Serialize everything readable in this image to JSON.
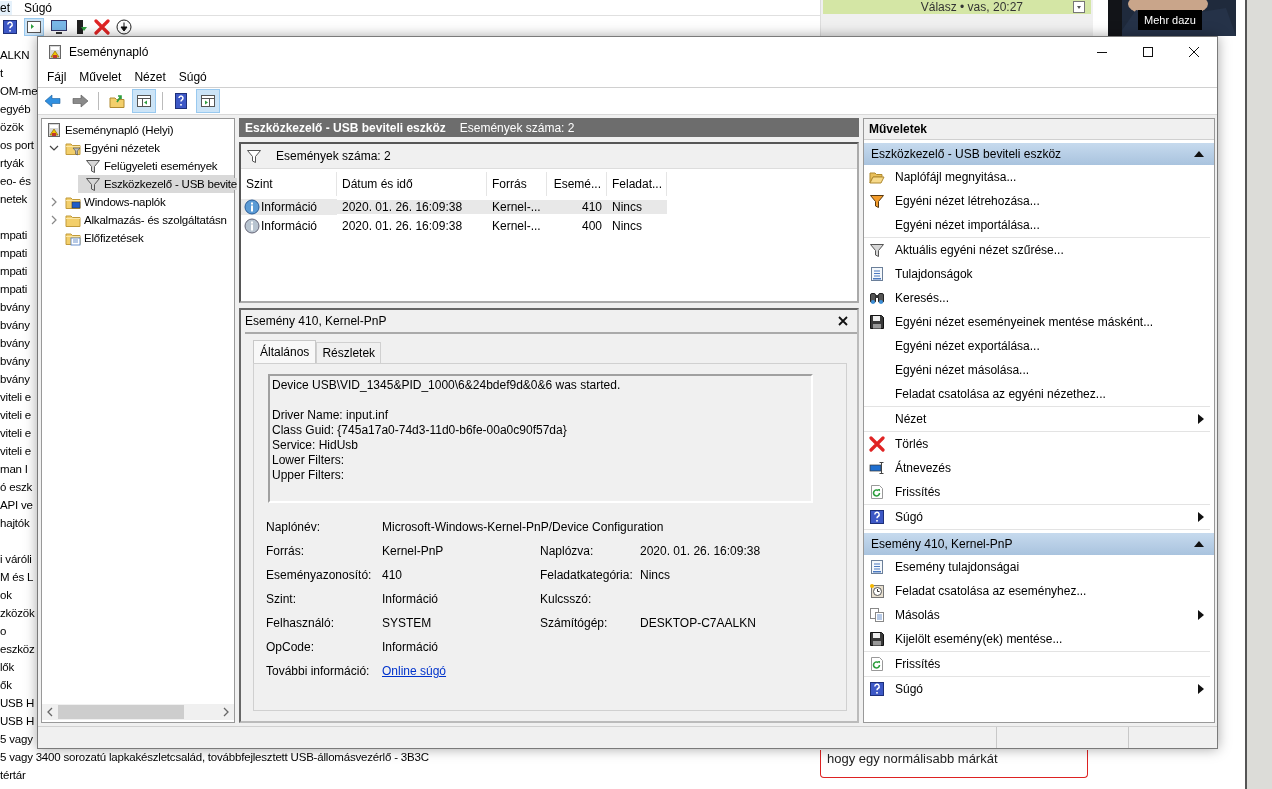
{
  "background_app": {
    "menu": [
      "et",
      "Súgó"
    ],
    "device_groups": [
      [
        "ALKN",
        "t",
        "OM-me",
        "egyéb",
        "özök",
        "os port",
        "rtyák",
        "eo- és",
        "netek"
      ],
      [
        "mpati",
        "mpati",
        "mpati",
        "mpati",
        "bvány",
        "bvány",
        "bvány",
        "bvány",
        "bvány",
        "viteli e",
        "viteli e",
        "viteli e",
        "viteli e",
        "man I",
        "ó eszk",
        "API ve",
        "hajtók"
      ],
      [
        "i váróli",
        "M és L",
        "ok",
        "zközök",
        "o",
        "eszköz",
        "lők",
        "ők",
        "USB H",
        "USB H",
        "5 vagy",
        "5 vagy 3400 sorozatú lapkakészletcsalád, továbbfejlesztett USB-állomásvezérlő - 3B3C",
        "tértár"
      ]
    ]
  },
  "web_page": {
    "reply_meta": "Válasz • vas, 20:27",
    "ad_label": "Mehr dazu",
    "comment_text": "hogy egy normálisabb márkát"
  },
  "window": {
    "title": "Eseménynapló",
    "menu": [
      "Fájl",
      "Művelet",
      "Nézet",
      "Súgó"
    ],
    "toolbar": [
      [
        {
          "kind": "back",
          "pressed": false
        },
        {
          "kind": "forward",
          "pressed": false
        }
      ],
      [
        {
          "kind": "up",
          "pressed": false
        },
        {
          "kind": "tree",
          "pressed": true
        }
      ],
      [
        {
          "kind": "help",
          "pressed": false
        },
        {
          "kind": "actionpane",
          "pressed": true
        }
      ]
    ]
  },
  "tree": [
    {
      "label": "Eseménynapló (Helyi)",
      "kind": "log",
      "selected": false,
      "children": [
        {
          "label": "Egyéni nézetek",
          "kind": "filterfolder",
          "expanded": true,
          "selected": false,
          "children": [
            {
              "label": "Felügyeleti események",
              "kind": "filter",
              "selected": false
            },
            {
              "label": "Eszközkezelő - USB bevite",
              "kind": "filter",
              "selected": true
            }
          ]
        },
        {
          "label": "Windows-naplók",
          "kind": "windowsfolder",
          "expanded": false,
          "selected": false
        },
        {
          "label": "Alkalmazás- és szolgáltatásn",
          "kind": "folder",
          "expanded": false,
          "selected": false
        },
        {
          "label": "Előfizetések",
          "kind": "subsfolder",
          "selected": false
        }
      ]
    }
  ],
  "events": {
    "header_title": "Eszközkezelő - USB beviteli eszköz",
    "header_count": "Események száma: 2",
    "filter_text": "Események száma: 2",
    "columns": [
      "Szint",
      "Dátum és idő",
      "Forrás",
      "Esemé...",
      "Feladat..."
    ],
    "rows": [
      {
        "selected": true,
        "kind": "info",
        "cells": [
          "Információ",
          "2020. 01. 26. 16:09:38",
          "Kernel-...",
          "410",
          "Nincs"
        ]
      },
      {
        "selected": false,
        "kind": "info",
        "cells": [
          "Információ",
          "2020. 01. 26. 16:09:38",
          "Kernel-...",
          "400",
          "Nincs"
        ]
      }
    ]
  },
  "detail": {
    "title": "Esemény 410, Kernel-PnP",
    "tabs": [
      {
        "label": "Általános",
        "selected": true
      },
      {
        "label": "Részletek",
        "selected": false
      }
    ],
    "description": "Device USB\\VID_1345&PID_1000\\6&24bdef9d&0&6 was started.\n\nDriver Name: input.inf\nClass Guid: {745a17a0-74d3-11d0-b6fe-00a0c90f57da}\nService: HidUsb\nLower Filters:\nUpper Filters:",
    "properties": [
      [
        {
          "label": "Naplónév:",
          "value": "Microsoft-Windows-Kernel-PnP/Device Configuration",
          "kind": "text"
        }
      ],
      [
        {
          "label": "Forrás:",
          "value": "Kernel-PnP",
          "kind": "text"
        },
        {
          "label": "Naplózva:",
          "value": "2020. 01. 26. 16:09:38",
          "kind": "text"
        }
      ],
      [
        {
          "label": "Eseményazonosító:",
          "value": "410",
          "kind": "text"
        },
        {
          "label": "Feladatkategória:",
          "value": "Nincs",
          "kind": "text"
        }
      ],
      [
        {
          "label": "Szint:",
          "value": "Információ",
          "kind": "text"
        },
        {
          "label": "Kulcsszó:"
        }
      ],
      [
        {
          "label": "Felhasználó:",
          "value": "SYSTEM",
          "kind": "text"
        },
        {
          "label": "Számítógép:",
          "value": "DESKTOP-C7AALKN",
          "kind": "text"
        }
      ],
      [
        {
          "label": "OpCode:",
          "value": "Információ",
          "kind": "text"
        }
      ],
      [
        {
          "label": "További információ:",
          "value": "Online súgó",
          "kind": "link"
        }
      ]
    ]
  },
  "actions": {
    "title": "Műveletek",
    "sections": [
      {
        "title": "Eszközkezelő - USB beviteli eszköz",
        "expanded": true,
        "groups": [
          [
            {
              "label": "Naplófájl megnyitása...",
              "kind": "openfolder",
              "submenu": false
            },
            {
              "label": "Egyéni nézet létrehozása...",
              "kind": "newfilter",
              "submenu": false
            },
            {
              "label": "Egyéni nézet importálása...",
              "kind": "plain",
              "submenu": false
            }
          ],
          [
            {
              "label": "Aktuális egyéni nézet szűrése...",
              "kind": "filter",
              "submenu": false
            },
            {
              "label": "Tulajdonságok",
              "kind": "properties",
              "submenu": false
            },
            {
              "label": "Keresés...",
              "kind": "binoculars",
              "submenu": false
            },
            {
              "label": "Egyéni nézet eseményeinek mentése másként...",
              "kind": "save",
              "submenu": false
            },
            {
              "label": "Egyéni nézet exportálása...",
              "kind": "plain",
              "submenu": false
            },
            {
              "label": "Egyéni nézet másolása...",
              "kind": "plain",
              "submenu": false
            },
            {
              "label": "Feladat csatolása az egyéni nézethez...",
              "kind": "plain",
              "submenu": false
            }
          ],
          [
            {
              "label": "Nézet",
              "kind": "plain",
              "submenu": true
            }
          ],
          [
            {
              "label": "Törlés",
              "kind": "delete",
              "submenu": false
            },
            {
              "label": "Átnevezés",
              "kind": "rename",
              "submenu": false
            },
            {
              "label": "Frissítés",
              "kind": "refresh",
              "submenu": false
            }
          ],
          [
            {
              "label": "Súgó",
              "kind": "help",
              "submenu": true
            }
          ]
        ]
      },
      {
        "title": "Esemény 410, Kernel-PnP",
        "expanded": true,
        "groups": [
          [
            {
              "label": "Esemény tulajdonságai",
              "kind": "properties",
              "submenu": false
            },
            {
              "label": "Feladat csatolása az eseményhez...",
              "kind": "taskclock",
              "submenu": false
            },
            {
              "label": "Másolás",
              "kind": "copy",
              "submenu": true
            },
            {
              "label": "Kijelölt esemény(ek) mentése...",
              "kind": "save",
              "submenu": false
            }
          ],
          [
            {
              "label": "Frissítés",
              "kind": "refresh",
              "submenu": false
            }
          ],
          [
            {
              "label": "Súgó",
              "kind": "help",
              "submenu": true
            }
          ]
        ]
      }
    ]
  }
}
